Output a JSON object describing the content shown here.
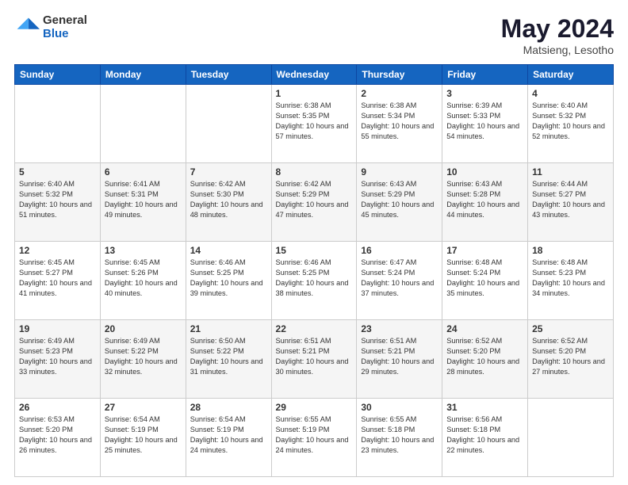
{
  "logo": {
    "general": "General",
    "blue": "Blue"
  },
  "title": "May 2024",
  "subtitle": "Matsieng, Lesotho",
  "days_of_week": [
    "Sunday",
    "Monday",
    "Tuesday",
    "Wednesday",
    "Thursday",
    "Friday",
    "Saturday"
  ],
  "weeks": [
    [
      {
        "day": "",
        "info": ""
      },
      {
        "day": "",
        "info": ""
      },
      {
        "day": "",
        "info": ""
      },
      {
        "day": "1",
        "info": "Sunrise: 6:38 AM\nSunset: 5:35 PM\nDaylight: 10 hours\nand 57 minutes."
      },
      {
        "day": "2",
        "info": "Sunrise: 6:38 AM\nSunset: 5:34 PM\nDaylight: 10 hours\nand 55 minutes."
      },
      {
        "day": "3",
        "info": "Sunrise: 6:39 AM\nSunset: 5:33 PM\nDaylight: 10 hours\nand 54 minutes."
      },
      {
        "day": "4",
        "info": "Sunrise: 6:40 AM\nSunset: 5:32 PM\nDaylight: 10 hours\nand 52 minutes."
      }
    ],
    [
      {
        "day": "5",
        "info": "Sunrise: 6:40 AM\nSunset: 5:32 PM\nDaylight: 10 hours\nand 51 minutes."
      },
      {
        "day": "6",
        "info": "Sunrise: 6:41 AM\nSunset: 5:31 PM\nDaylight: 10 hours\nand 49 minutes."
      },
      {
        "day": "7",
        "info": "Sunrise: 6:42 AM\nSunset: 5:30 PM\nDaylight: 10 hours\nand 48 minutes."
      },
      {
        "day": "8",
        "info": "Sunrise: 6:42 AM\nSunset: 5:29 PM\nDaylight: 10 hours\nand 47 minutes."
      },
      {
        "day": "9",
        "info": "Sunrise: 6:43 AM\nSunset: 5:29 PM\nDaylight: 10 hours\nand 45 minutes."
      },
      {
        "day": "10",
        "info": "Sunrise: 6:43 AM\nSunset: 5:28 PM\nDaylight: 10 hours\nand 44 minutes."
      },
      {
        "day": "11",
        "info": "Sunrise: 6:44 AM\nSunset: 5:27 PM\nDaylight: 10 hours\nand 43 minutes."
      }
    ],
    [
      {
        "day": "12",
        "info": "Sunrise: 6:45 AM\nSunset: 5:27 PM\nDaylight: 10 hours\nand 41 minutes."
      },
      {
        "day": "13",
        "info": "Sunrise: 6:45 AM\nSunset: 5:26 PM\nDaylight: 10 hours\nand 40 minutes."
      },
      {
        "day": "14",
        "info": "Sunrise: 6:46 AM\nSunset: 5:25 PM\nDaylight: 10 hours\nand 39 minutes."
      },
      {
        "day": "15",
        "info": "Sunrise: 6:46 AM\nSunset: 5:25 PM\nDaylight: 10 hours\nand 38 minutes."
      },
      {
        "day": "16",
        "info": "Sunrise: 6:47 AM\nSunset: 5:24 PM\nDaylight: 10 hours\nand 37 minutes."
      },
      {
        "day": "17",
        "info": "Sunrise: 6:48 AM\nSunset: 5:24 PM\nDaylight: 10 hours\nand 35 minutes."
      },
      {
        "day": "18",
        "info": "Sunrise: 6:48 AM\nSunset: 5:23 PM\nDaylight: 10 hours\nand 34 minutes."
      }
    ],
    [
      {
        "day": "19",
        "info": "Sunrise: 6:49 AM\nSunset: 5:23 PM\nDaylight: 10 hours\nand 33 minutes."
      },
      {
        "day": "20",
        "info": "Sunrise: 6:49 AM\nSunset: 5:22 PM\nDaylight: 10 hours\nand 32 minutes."
      },
      {
        "day": "21",
        "info": "Sunrise: 6:50 AM\nSunset: 5:22 PM\nDaylight: 10 hours\nand 31 minutes."
      },
      {
        "day": "22",
        "info": "Sunrise: 6:51 AM\nSunset: 5:21 PM\nDaylight: 10 hours\nand 30 minutes."
      },
      {
        "day": "23",
        "info": "Sunrise: 6:51 AM\nSunset: 5:21 PM\nDaylight: 10 hours\nand 29 minutes."
      },
      {
        "day": "24",
        "info": "Sunrise: 6:52 AM\nSunset: 5:20 PM\nDaylight: 10 hours\nand 28 minutes."
      },
      {
        "day": "25",
        "info": "Sunrise: 6:52 AM\nSunset: 5:20 PM\nDaylight: 10 hours\nand 27 minutes."
      }
    ],
    [
      {
        "day": "26",
        "info": "Sunrise: 6:53 AM\nSunset: 5:20 PM\nDaylight: 10 hours\nand 26 minutes."
      },
      {
        "day": "27",
        "info": "Sunrise: 6:54 AM\nSunset: 5:19 PM\nDaylight: 10 hours\nand 25 minutes."
      },
      {
        "day": "28",
        "info": "Sunrise: 6:54 AM\nSunset: 5:19 PM\nDaylight: 10 hours\nand 24 minutes."
      },
      {
        "day": "29",
        "info": "Sunrise: 6:55 AM\nSunset: 5:19 PM\nDaylight: 10 hours\nand 24 minutes."
      },
      {
        "day": "30",
        "info": "Sunrise: 6:55 AM\nSunset: 5:18 PM\nDaylight: 10 hours\nand 23 minutes."
      },
      {
        "day": "31",
        "info": "Sunrise: 6:56 AM\nSunset: 5:18 PM\nDaylight: 10 hours\nand 22 minutes."
      },
      {
        "day": "",
        "info": ""
      }
    ]
  ]
}
